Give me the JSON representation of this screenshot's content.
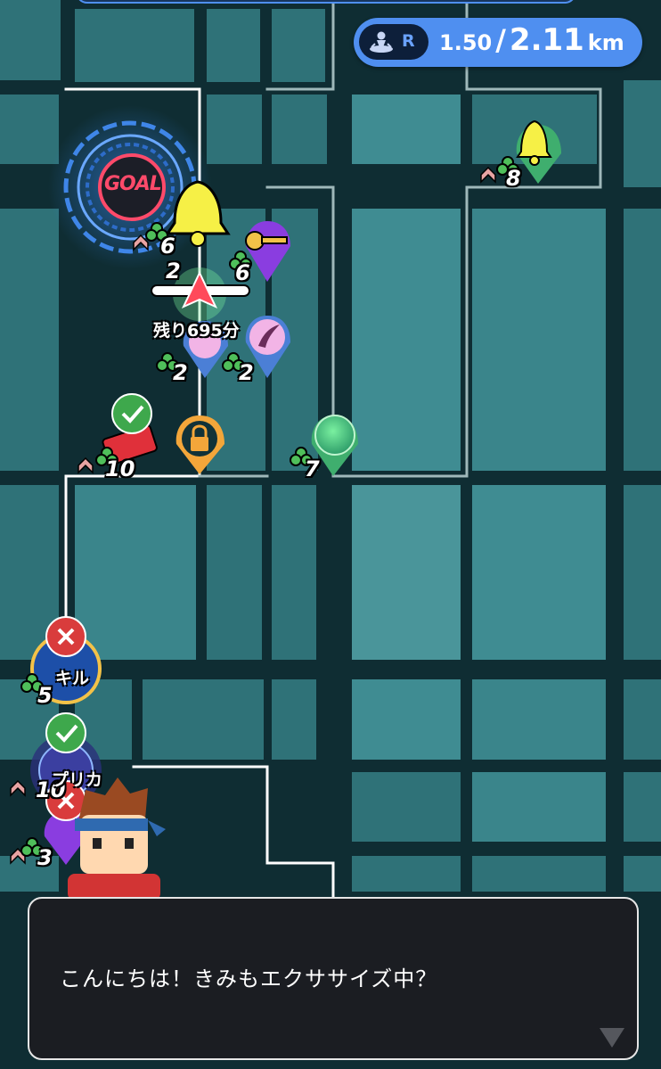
{
  "distance": {
    "mode_icon": "walker-map-pin-icon",
    "mode_letter": "R",
    "current": "1.50",
    "separator": "/",
    "total": "2.11",
    "unit": "km"
  },
  "goal": {
    "label": "GOAL"
  },
  "player": {
    "time_remaining": "残り695分"
  },
  "marker_counts": {
    "bell_top_right": "8",
    "bell_center": "6",
    "key_marker": "6",
    "player_hidden_prefix": "2",
    "pink_marker_left": "2",
    "pink_marker_right": "2",
    "red_box": "10",
    "green_orb": "7",
    "skill_marker": "5",
    "replica_marker": "10",
    "purple_marker": "3"
  },
  "map_labels": {
    "skill_label": "キル",
    "replica_label": "プリカ"
  },
  "dialogue": {
    "text": "こんにちは！きみもエクササイズ中？",
    "advance_icon": "down-triangle-icon"
  },
  "colors": {
    "map_background": "#0f2d33",
    "block": "#2f7278",
    "accent_pill": "#4f8ff0",
    "dialogue_bg": "#1b1d22"
  }
}
